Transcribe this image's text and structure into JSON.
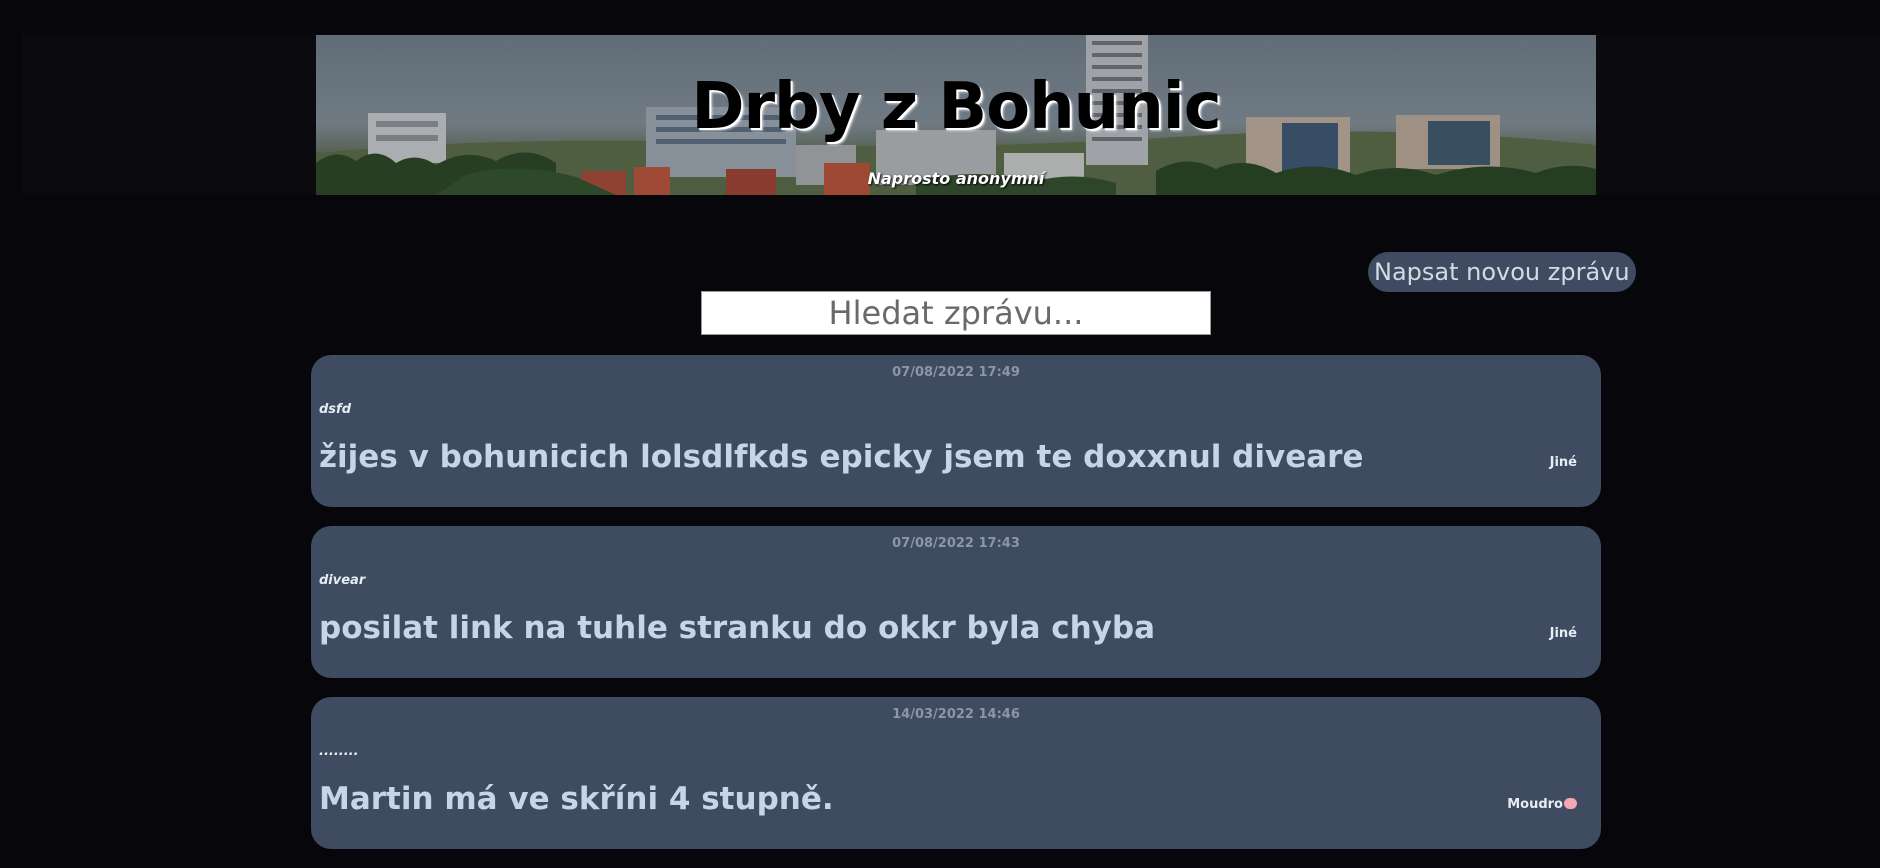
{
  "header": {
    "title": "Drby z Bohunic",
    "subtitle": "Naprosto anonymní"
  },
  "toolbar": {
    "new_message_label": "Napsat novou zprávu"
  },
  "search": {
    "placeholder": "Hledat zprávu..."
  },
  "messages": [
    {
      "date": "07/08/2022 17:49",
      "author": "dsfd",
      "text": "žijes v bohunicich lolsdlfkds epicky jsem te doxxnul diveare",
      "category": "Jiné",
      "category_icon": ""
    },
    {
      "date": "07/08/2022 17:43",
      "author": "divear",
      "text": "posilat link na tuhle stranku do okkr byla chyba",
      "category": "Jiné",
      "category_icon": ""
    },
    {
      "date": "14/03/2022 14:46",
      "author": "........",
      "text": "Martin má ve skříni 4 stupně.",
      "category": "Moudro",
      "category_icon": "brain-icon"
    }
  ],
  "colors": {
    "background": "#07060a",
    "card": "#3e4b60",
    "message_text": "#c6d5ea",
    "date_text": "#8b96a6"
  }
}
